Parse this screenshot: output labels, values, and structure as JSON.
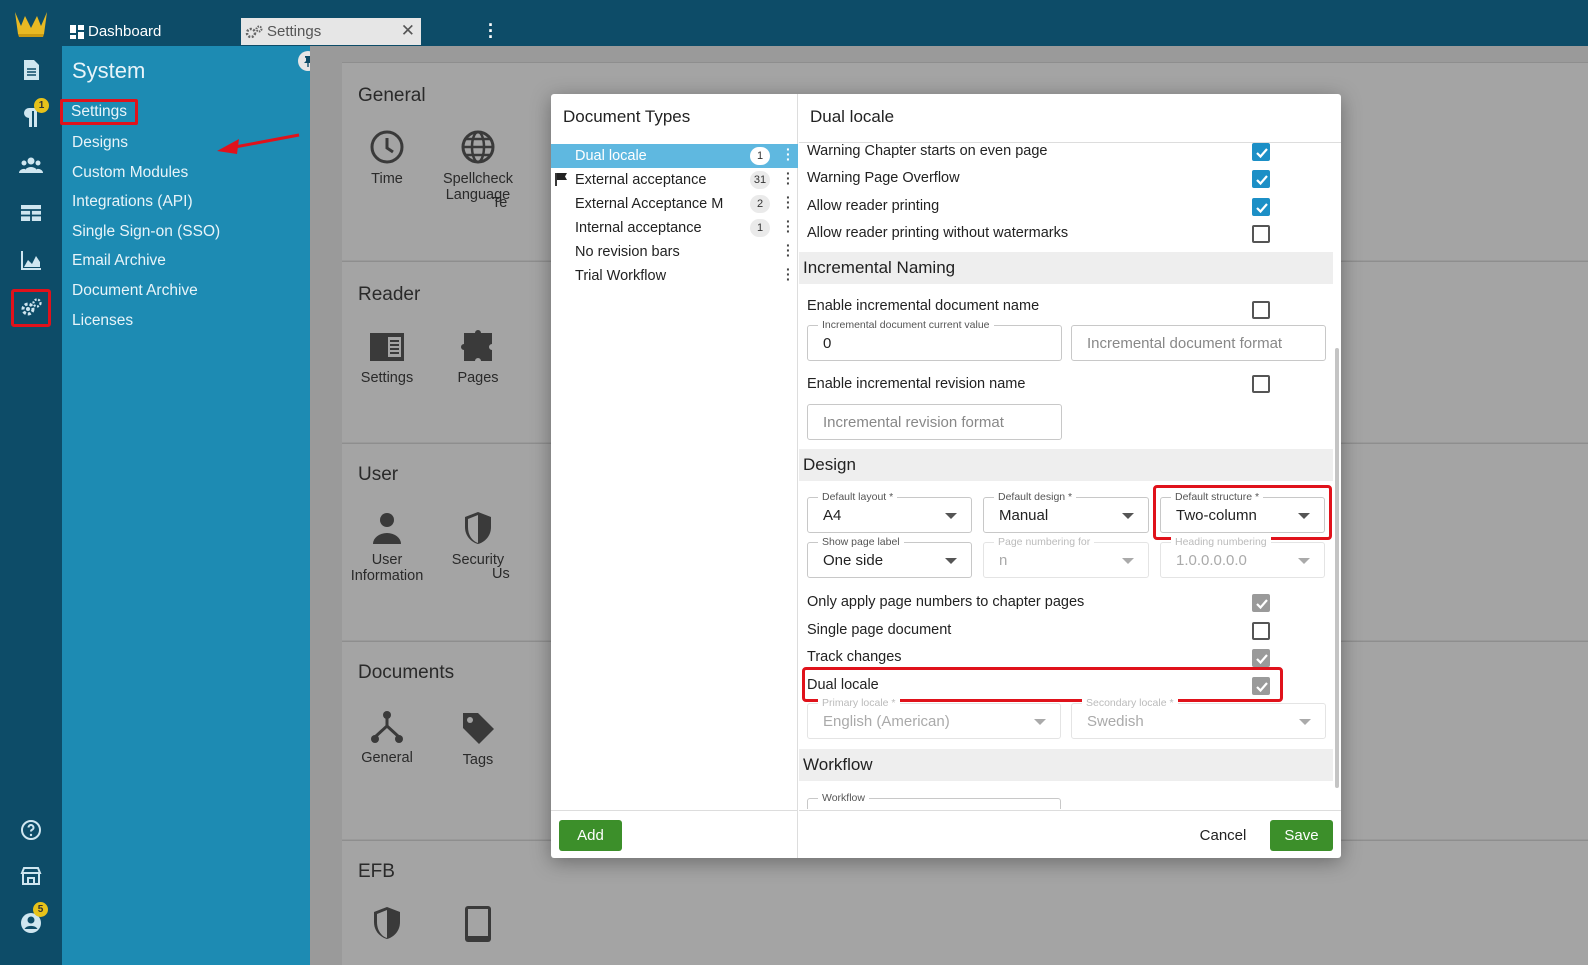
{
  "topbar": {
    "tabs": [
      {
        "label": "Dashboard",
        "icon": "dashboard-icon"
      },
      {
        "label": "Settings",
        "icon": "gears-icon"
      }
    ]
  },
  "rail": {
    "badges": {
      "paragraph": "1",
      "account": "5"
    }
  },
  "sidebar": {
    "title": "System",
    "items": [
      {
        "label": "Settings"
      },
      {
        "label": "Designs"
      },
      {
        "label": "Custom Modules"
      },
      {
        "label": "Integrations (API)"
      },
      {
        "label": "Single Sign-on (SSO)"
      },
      {
        "label": "Email Archive"
      },
      {
        "label": "Document Archive"
      },
      {
        "label": "Licenses"
      }
    ]
  },
  "background": {
    "sections": [
      {
        "title": "General",
        "tiles": [
          "Time",
          "Spellcheck Language",
          "Te"
        ]
      },
      {
        "title": "Reader",
        "tiles": [
          "Settings",
          "Pages"
        ]
      },
      {
        "title": "User",
        "tiles": [
          "User Information",
          "Security",
          "Us"
        ]
      },
      {
        "title": "Documents",
        "tiles": [
          "General",
          "Tags"
        ]
      },
      {
        "title": "EFB",
        "tiles": [
          "",
          ""
        ]
      }
    ]
  },
  "modal": {
    "left_title": "Document Types",
    "doc_types": [
      {
        "name": "Dual locale",
        "count": "1",
        "selected": true
      },
      {
        "name": "External acceptance",
        "count": "31",
        "flag": true
      },
      {
        "name": "External Acceptance M",
        "count": "2"
      },
      {
        "name": "Internal acceptance",
        "count": "1"
      },
      {
        "name": "No revision bars",
        "count": ""
      },
      {
        "name": "Trial Workflow",
        "count": ""
      }
    ],
    "add_label": "Add",
    "right_title": "Dual locale",
    "checks_top": [
      {
        "label": "Warning Chapter starts on even page",
        "checked": true
      },
      {
        "label": "Warning Page Overflow",
        "checked": true
      },
      {
        "label": "Allow reader printing",
        "checked": true
      },
      {
        "label": "Allow reader printing without watermarks",
        "checked": false
      }
    ],
    "incremental": {
      "section": "Incremental Naming",
      "enable_doc_label": "Enable incremental document name",
      "current_value_label": "Incremental document current value",
      "current_value": "0",
      "doc_format_placeholder": "Incremental document format",
      "enable_rev_label": "Enable incremental revision name",
      "rev_format_placeholder": "Incremental revision format"
    },
    "design": {
      "section": "Design",
      "default_layout_label": "Default layout *",
      "default_layout": "A4",
      "default_design_label": "Default design *",
      "default_design": "Manual",
      "default_structure_label": "Default structure *",
      "default_structure": "Two-column",
      "show_page_label_label": "Show page label",
      "show_page_label": "One side",
      "page_numbering_label": "Page numbering for",
      "page_numbering": "n",
      "heading_numbering_label": "Heading numbering",
      "heading_numbering": "1.0.0.0.0.0",
      "only_chapter_label": "Only apply page numbers to chapter pages",
      "single_page_label": "Single page document",
      "track_changes_label": "Track changes",
      "dual_locale_label": "Dual locale",
      "primary_locale_label": "Primary locale *",
      "primary_locale": "English (American)",
      "secondary_locale_label": "Secondary locale *",
      "secondary_locale": "Swedish"
    },
    "workflow": {
      "section": "Workflow",
      "workflow_label": "Workflow"
    },
    "cancel_label": "Cancel",
    "save_label": "Save"
  }
}
